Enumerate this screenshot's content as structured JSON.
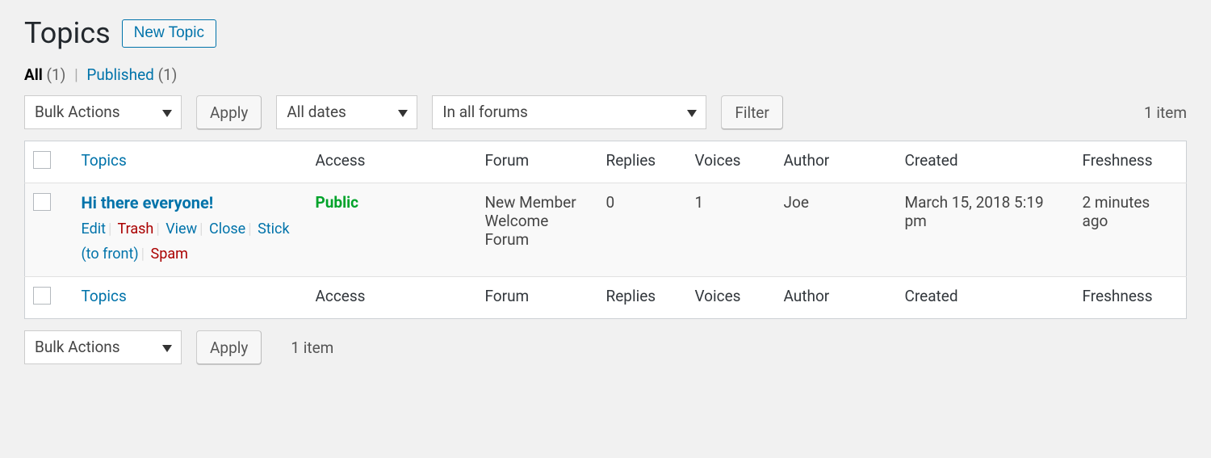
{
  "page": {
    "title": "Topics",
    "new_button": "New Topic"
  },
  "filters": {
    "all_label": "All",
    "all_count": "(1)",
    "published_label": "Published",
    "published_count": "(1)"
  },
  "controls": {
    "bulk_label": "Bulk Actions",
    "apply_label": "Apply",
    "dates_label": "All dates",
    "forums_label": "In all forums",
    "filter_label": "Filter",
    "item_count": "1 item"
  },
  "columns": {
    "topics": "Topics",
    "access": "Access",
    "forum": "Forum",
    "replies": "Replies",
    "voices": "Voices",
    "author": "Author",
    "created": "Created",
    "freshness": "Freshness"
  },
  "rows": [
    {
      "title": "Hi there everyone!",
      "actions": {
        "edit": "Edit",
        "trash": "Trash",
        "view": "View",
        "close": "Close",
        "stick": "Stick (to front)",
        "spam": "Spam"
      },
      "access": "Public",
      "forum": "New Member Welcome Forum",
      "replies": "0",
      "voices": "1",
      "author": "Joe",
      "created": "March 15, 2018 5:19 pm",
      "freshness": "2 minutes ago"
    }
  ]
}
